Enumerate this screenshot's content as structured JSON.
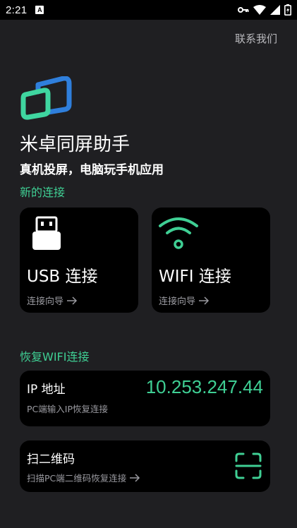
{
  "status_bar": {
    "time": "2:21",
    "notification_icon": "a-icon",
    "icons": [
      "key-icon",
      "wifi-icon",
      "signal-icon",
      "battery-icon"
    ]
  },
  "header": {
    "contact_label": "联系我们"
  },
  "app": {
    "title": "米卓同屏助手",
    "subtitle": "真机投屏，电脑玩手机应用"
  },
  "new_connection": {
    "section_title": "新的连接",
    "usb": {
      "label": "USB 连接",
      "guide": "连接向导",
      "icon": "usb-icon"
    },
    "wifi": {
      "label": "WIFI 连接",
      "guide": "连接向导",
      "icon": "wifi-icon"
    }
  },
  "restore": {
    "section_title": "恢复WIFI连接",
    "ip": {
      "title": "IP 地址",
      "hint": "PC端输入IP恢复连接",
      "value": "10.253.247.44"
    },
    "qr": {
      "title": "扫二维码",
      "hint": "扫描PC端二维码恢复连接",
      "icon": "scan-icon"
    }
  },
  "colors": {
    "accent": "#3fcf94",
    "background": "#1f1f22",
    "card": "#000000",
    "logo_blue": "#2f7fdc",
    "logo_green": "#3fd6a0"
  }
}
